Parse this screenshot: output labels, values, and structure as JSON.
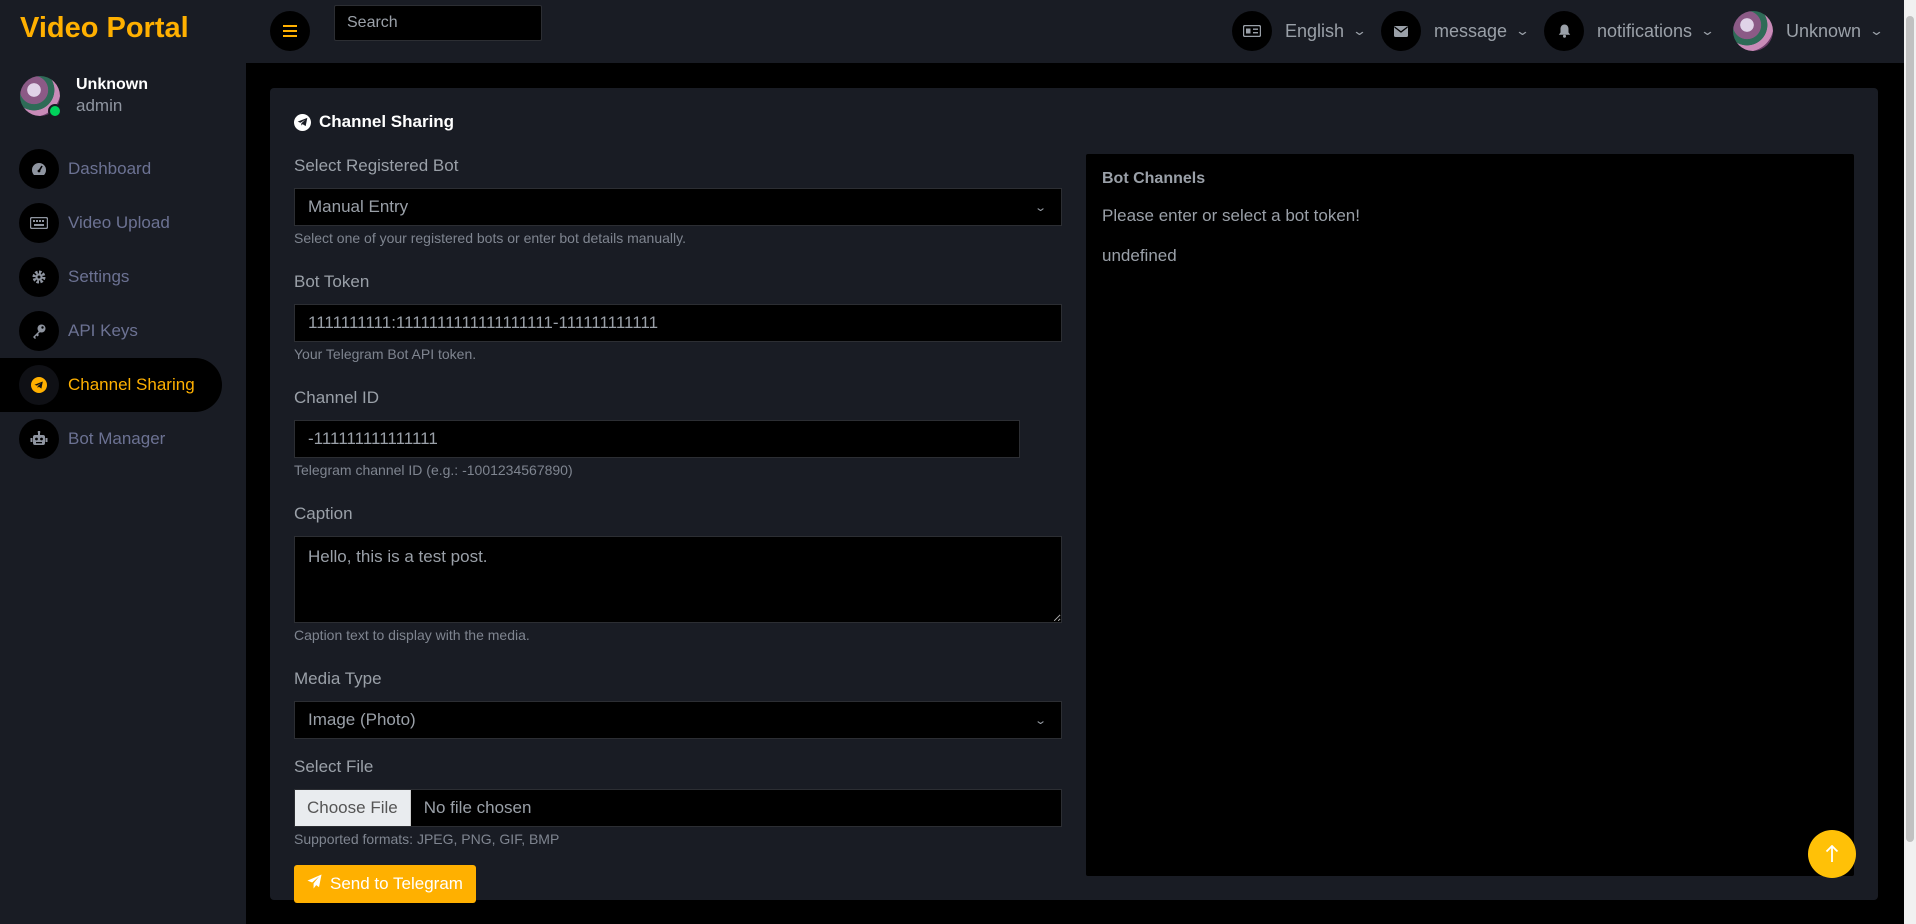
{
  "app": {
    "title": "Video Portal"
  },
  "profile": {
    "name": "Unknown",
    "role": "admin"
  },
  "sidebar": {
    "items": [
      {
        "label": "Dashboard",
        "icon": "gauge-icon"
      },
      {
        "label": "Video Upload",
        "icon": "keyboard-icon"
      },
      {
        "label": "Settings",
        "icon": "gear-icon"
      },
      {
        "label": "API Keys",
        "icon": "key-icon"
      },
      {
        "label": "Channel Sharing",
        "icon": "telegram-icon",
        "active": true
      },
      {
        "label": "Bot Manager",
        "icon": "robot-icon"
      }
    ]
  },
  "topbar": {
    "search_placeholder": "Search",
    "language": "English",
    "message": "message",
    "notifications": "notifications",
    "user": "Unknown"
  },
  "card": {
    "title": "Channel Sharing",
    "form": {
      "bot_select": {
        "label": "Select Registered Bot",
        "value": "Manual Entry",
        "help": "Select one of your registered bots or enter bot details manually."
      },
      "bot_token": {
        "label": "Bot Token",
        "value": "1111111111:1111111111111111111-111111111111",
        "help": "Your Telegram Bot API token."
      },
      "channel_id": {
        "label": "Channel ID",
        "value": "-111111111111111",
        "help": "Telegram channel ID (e.g.: -1001234567890)"
      },
      "caption": {
        "label": "Caption",
        "value": "Hello, this is a test post.",
        "help": "Caption text to display with the media."
      },
      "media_type": {
        "label": "Media Type",
        "value": "Image (Photo)"
      },
      "file": {
        "label": "Select File",
        "button": "Choose File",
        "status": "No file chosen",
        "help": "Supported formats: JPEG, PNG, GIF, BMP"
      },
      "submit": "Send to Telegram"
    },
    "panel": {
      "title": "Bot Channels",
      "message": "Please enter or select a bot token!",
      "extra": "undefined"
    }
  },
  "colors": {
    "accent": "#ffb000",
    "sidebar_bg": "#191c24",
    "page_bg": "#000000"
  }
}
